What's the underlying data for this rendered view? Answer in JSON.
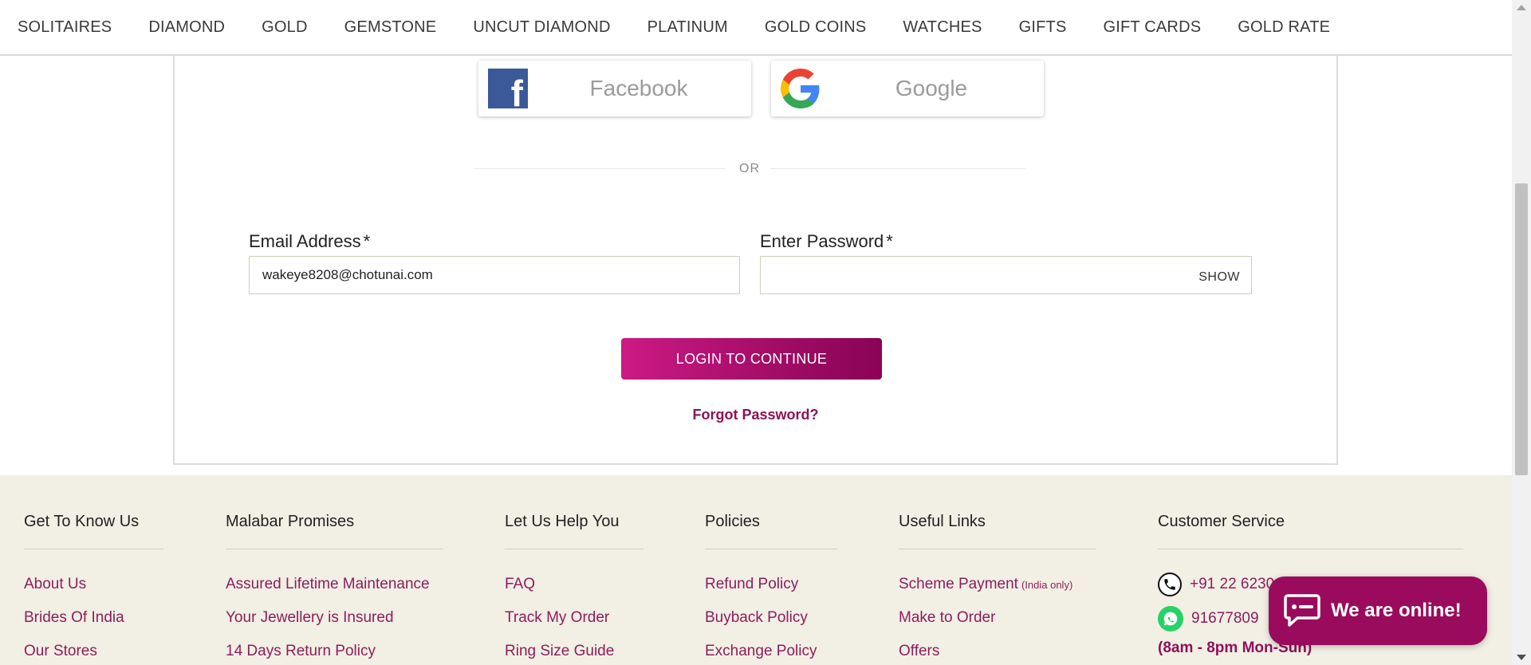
{
  "nav": {
    "items": [
      "SOLITAIRES",
      "DIAMOND",
      "GOLD",
      "GEMSTONE",
      "UNCUT DIAMOND",
      "PLATINUM",
      "GOLD COINS",
      "WATCHES",
      "GIFTS",
      "GIFT CARDS",
      "GOLD RATE"
    ]
  },
  "login": {
    "facebook_label": "Facebook",
    "google_label": "Google",
    "or_text": "OR",
    "email_label": "Email Address",
    "email_value": "wakeye8208@chotunai.com",
    "password_label": "Enter Password",
    "required_mark": "*",
    "show_label": "SHOW",
    "submit_label": "LOGIN TO CONTINUE",
    "forgot_label": "Forgot Password?"
  },
  "footer": {
    "get_to_know": {
      "heading": "Get To Know Us",
      "links": [
        "About Us",
        "Brides Of India",
        "Our Stores"
      ]
    },
    "promises": {
      "heading": "Malabar Promises",
      "links": [
        "Assured Lifetime Maintenance",
        "Your Jewellery is Insured",
        "14 Days Return Policy"
      ]
    },
    "help": {
      "heading": "Let Us Help You",
      "links": [
        "FAQ",
        "Track My Order",
        "Ring Size Guide"
      ]
    },
    "policies": {
      "heading": "Policies",
      "links": [
        "Refund Policy",
        "Buyback Policy",
        "Exchange Policy"
      ]
    },
    "useful": {
      "heading": "Useful Links",
      "scheme_label": "Scheme Payment",
      "scheme_note": "(India only)",
      "links": [
        "Make to Order",
        "Offers"
      ]
    },
    "customer_service": {
      "heading": "Customer Service",
      "phone": "+91 22 6230",
      "whatsapp": "91677809",
      "hours": "(8am - 8pm Mon-Sun)"
    }
  },
  "chat": {
    "label": "We are online!"
  },
  "colors": {
    "brand": "#9a0b5d",
    "link": "#8e1e5a",
    "footer_bg": "#f2efe5"
  }
}
